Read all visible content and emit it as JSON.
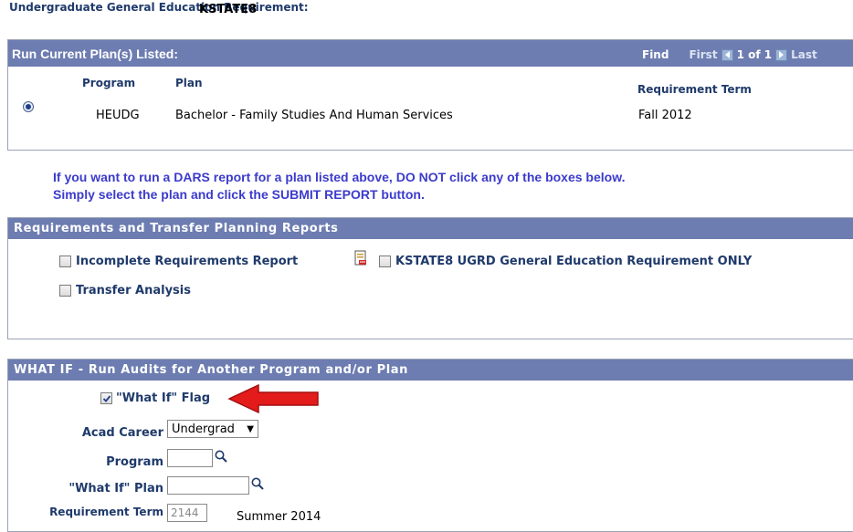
{
  "header": {
    "label": "Undergraduate General Education Requirement:",
    "value": "KSTATE8"
  },
  "plans": {
    "title": "Run Current Plan(s) Listed:",
    "nav": {
      "find": "Find",
      "first": "First",
      "count": "1 of 1",
      "last": "Last"
    },
    "columns": {
      "program": "Program",
      "plan": "Plan",
      "term": "Requirement Term"
    },
    "row": {
      "program": "HEUDG",
      "plan": "Bachelor - Family Studies And Human Services",
      "term": "Fall 2012",
      "selected": true
    }
  },
  "notice": {
    "line1": "If you want to run a DARS report for a plan listed above, DO NOT click any of the boxes below.",
    "line2": "Simply select the plan and click the SUBMIT REPORT button."
  },
  "reports": {
    "title": "Requirements and Transfer Planning Reports",
    "incomplete": {
      "label": "Incomplete Requirements Report",
      "checked": false
    },
    "kstate8": {
      "label": "KSTATE8 UGRD General Education Requirement ONLY",
      "checked": false
    },
    "transfer": {
      "label": "Transfer Analysis",
      "checked": false
    }
  },
  "whatif": {
    "title": "WHAT IF - Run Audits for Another Program and/or Plan",
    "flag": {
      "label": "\"What If\" Flag",
      "checked": true
    },
    "acad_career": {
      "label": "Acad Career",
      "value": "Undergrad"
    },
    "program": {
      "label": "Program",
      "value": ""
    },
    "plan": {
      "label": "\"What If\" Plan",
      "value": ""
    },
    "req_term": {
      "label": "Requirement Term",
      "value": "2144",
      "description": "Summer 2014"
    }
  },
  "colors": {
    "bar": "#6d7db1",
    "label": "#1f3a6b",
    "notice": "#3b3bcc",
    "arrow": "#e31b1b"
  }
}
